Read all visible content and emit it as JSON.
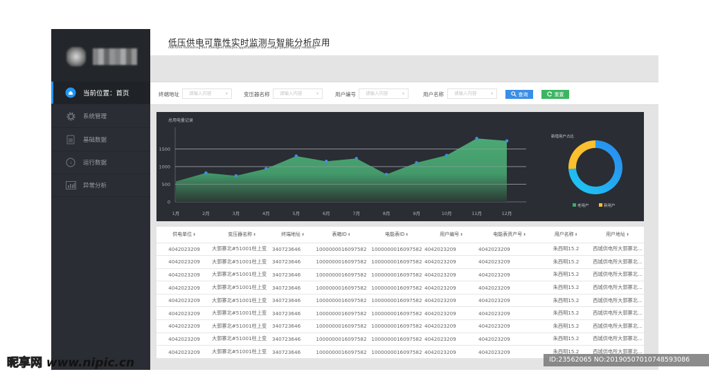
{
  "app": {
    "title": "低压供电可靠性实时监测与智能分析应用",
    "subtitle": "real-time monitoring and intelligent analysis application of low voltage power supply reliability"
  },
  "sidebar": {
    "items": [
      {
        "label": "当前位置：首页",
        "icon": "home-icon",
        "active": true
      },
      {
        "label": "系统管理",
        "icon": "gear-icon",
        "active": false
      },
      {
        "label": "基础数据",
        "icon": "document-icon",
        "active": false
      },
      {
        "label": "运行数据",
        "icon": "gauge-icon",
        "active": false
      },
      {
        "label": "异常分析",
        "icon": "bar-chart-icon",
        "active": false
      }
    ]
  },
  "filters": {
    "fields": [
      {
        "label": "终端地址",
        "placeholder": "请输入内容"
      },
      {
        "label": "变压器名称",
        "placeholder": "请输入内容"
      },
      {
        "label": "用户编号",
        "placeholder": "请输入内容"
      },
      {
        "label": "用户名称",
        "placeholder": "请输入内容"
      }
    ],
    "query_label": "查询",
    "reset_label": "重置"
  },
  "chart_data": [
    {
      "type": "area",
      "title": "总用电量记录",
      "xlabel": "",
      "ylabel": "",
      "categories": [
        "1月",
        "2月",
        "3月",
        "4月",
        "5月",
        "6月",
        "7月",
        "8月",
        "9月",
        "10月",
        "11月",
        "12月"
      ],
      "values": [
        580,
        820,
        740,
        940,
        1300,
        1150,
        1230,
        780,
        1110,
        1320,
        1800,
        1730
      ],
      "yticks": [
        0,
        500,
        1000,
        1500
      ],
      "ylim": [
        0,
        2000
      ],
      "grid": true,
      "colors": {
        "area": "#4caf78",
        "point": "#3d8fe0"
      }
    },
    {
      "type": "pie",
      "title": "新增用户占比",
      "donut": true,
      "series": [
        {
          "name": "老用户",
          "value": 74,
          "color": "#2196f3",
          "legend_color": "#3daa6a"
        },
        {
          "name": "新用户",
          "value": 26,
          "color": "#fbc02d",
          "legend_color": "#fbc02d"
        }
      ],
      "legend_position": "bottom"
    }
  ],
  "table": {
    "columns": [
      "供电单位",
      "变压器名称",
      "终端地址",
      "表箱ID",
      "电能表ID",
      "用户编号",
      "电能表资产号",
      "用户名称",
      "用户地址"
    ],
    "rows": [
      [
        "4042023209",
        "大郭寨北#51001柱上变",
        "340723646",
        "1000000016097582",
        "1000000016097582",
        "4042023209",
        "4042023209",
        "朱西明15.2",
        "西城供电所大郭寨北..."
      ],
      [
        "4042023209",
        "大郭寨北#51001柱上变",
        "340723646",
        "1000000016097582",
        "1000000016097582",
        "4042023209",
        "4042023209",
        "朱西明15.2",
        "西城供电所大郭寨北..."
      ],
      [
        "4042023209",
        "大郭寨北#51001柱上变",
        "340723646",
        "1000000016097582",
        "1000000016097582",
        "4042023209",
        "4042023209",
        "朱西明15.2",
        "西城供电所大郭寨北..."
      ],
      [
        "4042023209",
        "大郭寨北#51001柱上变",
        "340723646",
        "1000000016097582",
        "1000000016097582",
        "4042023209",
        "4042023209",
        "朱西明15.2",
        "西城供电所大郭寨北..."
      ],
      [
        "4042023209",
        "大郭寨北#51001柱上变",
        "340723646",
        "1000000016097582",
        "1000000016097582",
        "4042023209",
        "4042023209",
        "朱西明15.2",
        "西城供电所大郭寨北..."
      ],
      [
        "4042023209",
        "大郭寨北#51001柱上变",
        "340723646",
        "1000000016097582",
        "1000000016097582",
        "4042023209",
        "4042023209",
        "朱西明15.2",
        "西城供电所大郭寨北..."
      ],
      [
        "4042023209",
        "大郭寨北#51001柱上变",
        "340723646",
        "1000000016097582",
        "1000000016097582",
        "4042023209",
        "4042023209",
        "朱西明15.2",
        "西城供电所大郭寨北..."
      ],
      [
        "4042023209",
        "大郭寨北#51001柱上变",
        "340723646",
        "1000000016097582",
        "1000000016097582",
        "4042023209",
        "4042023209",
        "朱西明15.2",
        "西城供电所大郭寨北..."
      ],
      [
        "4042023209",
        "大郭寨北#51001柱上变",
        "340723646",
        "1000000016097582",
        "1000000016097582",
        "4042023209",
        "4042023209",
        "朱西明15.2",
        "西城供电所大郭寨北..."
      ]
    ]
  },
  "watermark": {
    "site_logo": "昵享网",
    "site_url": "www.nipic.cn",
    "id_text": "ID:23562065 NO:20190507010748593086"
  },
  "colors": {
    "sidebar_bg": "#2a2d33",
    "accent_blue": "#2196f3",
    "query_button": "#3a8ee6",
    "reset_button": "#3cb563"
  }
}
